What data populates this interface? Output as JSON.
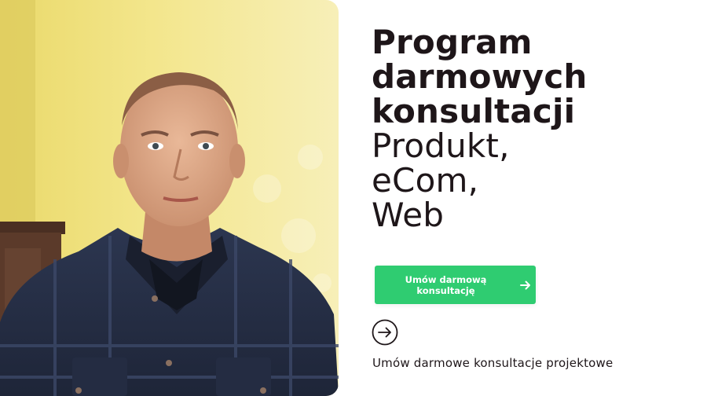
{
  "hero": {
    "title_bold_lines": [
      "Program",
      "darmowych",
      "konsultacji"
    ],
    "title_light_lines": [
      "Produkt,",
      "eCom,",
      "Web"
    ]
  },
  "cta": {
    "label": "Umów darmową konsultację",
    "icon": "arrow-right-icon"
  },
  "secondary": {
    "icon": "circle-arrow-right-icon",
    "caption": "Umów darmowe konsultacje projektowe"
  },
  "colors": {
    "accent": "#2fcc71",
    "text": "#1e1619",
    "background": "#ffffff"
  }
}
